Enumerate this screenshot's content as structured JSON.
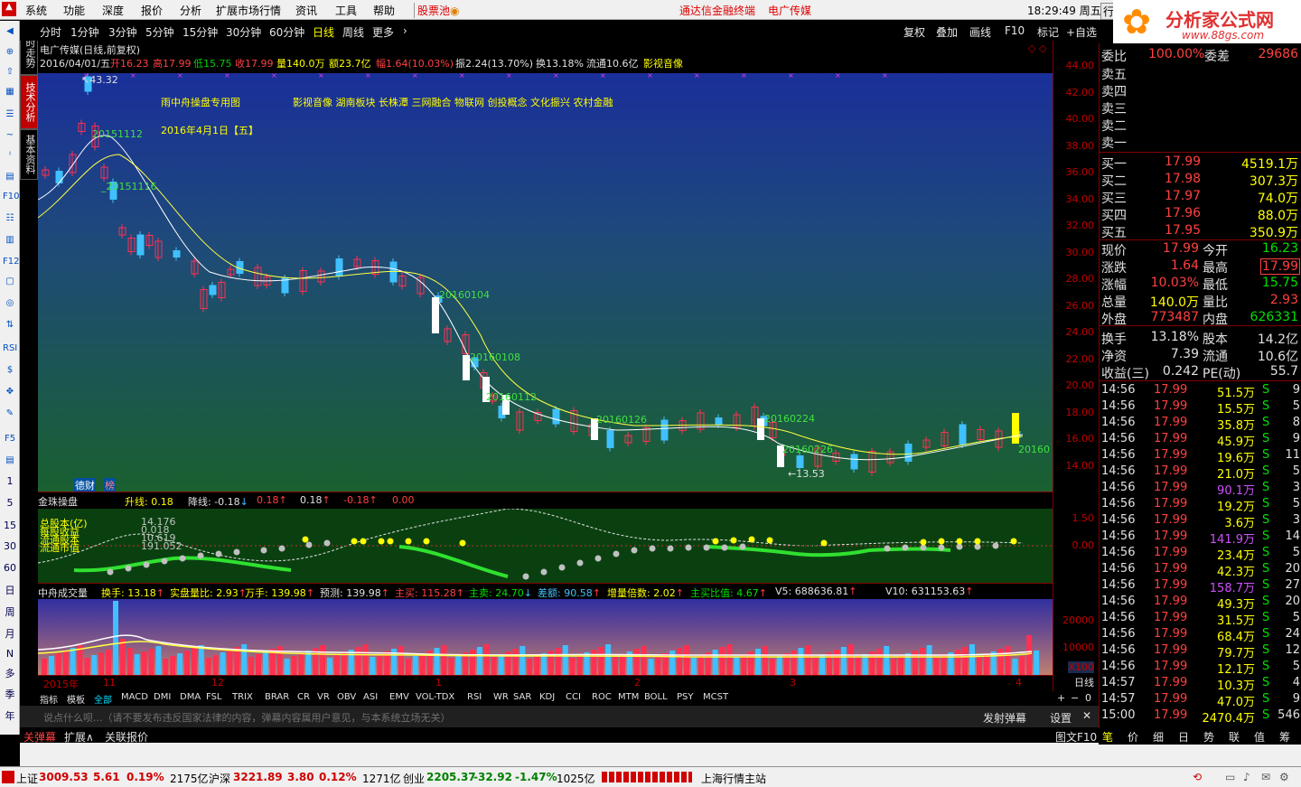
{
  "menu": {
    "items": [
      "系统",
      "功能",
      "深度",
      "报价",
      "分析",
      "扩展市场行情",
      "资讯",
      "工具",
      "帮助"
    ],
    "stockpool": "股票池",
    "promo1": "通达信金融终端",
    "promo2": "电广传媒",
    "time": "18:29:49 周五",
    "trade_btn": "行"
  },
  "logo": {
    "text": "分析家公式网",
    "url": "www.88gs.com"
  },
  "toolbar": {
    "periods": [
      "分时",
      "1分钟",
      "3分钟",
      "5分钟",
      "15分钟",
      "30分钟",
      "60分钟",
      "日线",
      "周线",
      "更多"
    ],
    "selected": "日线",
    "right": [
      "复权",
      "叠加",
      "画线",
      "F10",
      "标记",
      "+自选"
    ]
  },
  "vtabs": [
    "分时走势",
    "技术分析",
    "基本资料"
  ],
  "left_tools": [
    "◀",
    "⊕",
    "⇧",
    "▦",
    "☰",
    "~",
    "ᴵ",
    "▤",
    "F10",
    "☷",
    "▥",
    "F12",
    "▢",
    "◎",
    "⇅",
    "RSI",
    "$",
    "✥",
    "✎",
    "F5",
    "▤",
    "1",
    "5",
    "15",
    "30",
    "60",
    "日",
    "周",
    "月",
    "N",
    "多",
    "季",
    "年"
  ],
  "main_chart": {
    "title": "电广传媒(日线,前复权)",
    "info_date": "2016/04/01/五",
    "info_open": "开16.23",
    "info_high": "高17.99",
    "info_low": "低15.75",
    "info_close": "收17.99",
    "info_vol": "量140.0万",
    "info_amt": "额23.7亿",
    "info_pct": "幅1.64(10.03%)",
    "info_amp": "振2.24(13.70%)",
    "info_turn": "换13.18%",
    "info_float": "流通10.6亿",
    "info_concept": "影视音像",
    "overlay_title": "雨中舟操盘专用图",
    "overlay_concepts": "影视音像  湖南板块  长株潭  三网融合  物联网  创投概念  文化振兴  农村金融",
    "overlay_date": "2016年4月1日【五】",
    "labels": [
      "43.32",
      "20151112",
      "20151116",
      "20160104",
      "20160108",
      "20160112",
      "20160126",
      "20160224",
      "20160226",
      "←13.53",
      "20160"
    ],
    "tags": [
      "德财",
      "榜"
    ],
    "price_axis": [
      "44.00",
      "42.00",
      "40.00",
      "38.00",
      "36.00",
      "34.00",
      "32.00",
      "30.00",
      "28.00",
      "26.00",
      "24.00",
      "22.00",
      "20.00",
      "18.00",
      "16.00",
      "14.00"
    ]
  },
  "indicator1": {
    "name": "金珠操盘",
    "values": [
      "升线: 0.18",
      "降线: -0.18",
      "0.18",
      "0.18",
      "-0.18",
      "0.00"
    ],
    "legend": [
      "总股本(亿)",
      "每股收益",
      "流通股本",
      "流通市值"
    ],
    "legend_vals": [
      "14.176",
      "0.018",
      "10.619",
      "191.052"
    ],
    "axis": [
      "1.50",
      "0.00"
    ]
  },
  "indicator2": {
    "name": "中舟成交量",
    "values": [
      "换手: 13.18",
      "实盘量比: 2.93",
      "万手: 139.98",
      "预测: 139.98",
      "主买: 115.28",
      "主卖: 24.70",
      "差额: 90.58",
      "增量倍数: 2.02",
      "主买比值: 4.67",
      "V5: 688636.81",
      "V10: 631153.63"
    ],
    "axis": [
      "20000",
      "10000",
      "X100"
    ],
    "months": [
      "2015年",
      "11",
      "12",
      "1",
      "2",
      "3",
      "4"
    ]
  },
  "bottom_tabs": [
    "指标",
    "模板",
    "全部",
    "MACD",
    "DMI",
    "DMA",
    "FSL",
    "TRIX",
    "BRAR",
    "CR",
    "VR",
    "OBV",
    "ASI",
    "EMV",
    "VOL-TDX",
    "RSI",
    "WR",
    "SAR",
    "KDJ",
    "CCI",
    "ROC",
    "MTM",
    "BOLL",
    "PSY",
    "MCST"
  ],
  "danmu": {
    "placeholder": "说点什么呗...（请不要发布违反国家法律的内容，弹幕内容属用户意见，与本系统立场无关）",
    "send": "发射弹幕",
    "settings": "设置"
  },
  "bar2": {
    "items": [
      "关弹幕",
      "扩展∧",
      "关联报价"
    ],
    "right": "图文F10",
    "period": "日线"
  },
  "quote": {
    "weibi": "委比",
    "weibi_val": "100.00%",
    "weicha": "委差",
    "weicha_val": "29686",
    "sell": [
      {
        "l": "卖五"
      },
      {
        "l": "卖四"
      },
      {
        "l": "卖三"
      },
      {
        "l": "卖二"
      },
      {
        "l": "卖一"
      }
    ],
    "buy": [
      {
        "l": "买一",
        "p": "17.99",
        "v": "4519.1万"
      },
      {
        "l": "买二",
        "p": "17.98",
        "v": "307.3万"
      },
      {
        "l": "买三",
        "p": "17.97",
        "v": "74.0万"
      },
      {
        "l": "买四",
        "p": "17.96",
        "v": "88.0万"
      },
      {
        "l": "买五",
        "p": "17.95",
        "v": "350.9万"
      }
    ],
    "stats": [
      {
        "a": "现价",
        "av": "17.99",
        "b": "今开",
        "bv": "16.23"
      },
      {
        "a": "涨跌",
        "av": "1.64",
        "b": "最高",
        "bv": "17.99"
      },
      {
        "a": "涨幅",
        "av": "10.03%",
        "b": "最低",
        "bv": "15.75"
      },
      {
        "a": "总量",
        "av": "140.0万",
        "b": "量比",
        "bv": "2.93"
      },
      {
        "a": "外盘",
        "av": "773487",
        "b": "内盘",
        "bv": "626331"
      },
      {
        "a": "换手",
        "av": "13.18%",
        "b": "股本",
        "bv": "14.2亿"
      },
      {
        "a": "净资",
        "av": "7.39",
        "b": "流通",
        "bv": "10.6亿"
      },
      {
        "a": "收益(三)",
        "av": "0.242",
        "b": "PE(动)",
        "bv": "55.7"
      }
    ],
    "ticks": [
      {
        "t": "14:56",
        "p": "17.99",
        "v": "51.5万",
        "s": "S",
        "n": "9"
      },
      {
        "t": "14:56",
        "p": "17.99",
        "v": "15.5万",
        "s": "S",
        "n": "5"
      },
      {
        "t": "14:56",
        "p": "17.99",
        "v": "35.8万",
        "s": "S",
        "n": "8"
      },
      {
        "t": "14:56",
        "p": "17.99",
        "v": "45.9万",
        "s": "S",
        "n": "9"
      },
      {
        "t": "14:56",
        "p": "17.99",
        "v": "19.6万",
        "s": "S",
        "n": "11"
      },
      {
        "t": "14:56",
        "p": "17.99",
        "v": "21.0万",
        "s": "S",
        "n": "5"
      },
      {
        "t": "14:56",
        "p": "17.99",
        "v": "90.1万",
        "s": "S",
        "n": "3"
      },
      {
        "t": "14:56",
        "p": "17.99",
        "v": "19.2万",
        "s": "S",
        "n": "5"
      },
      {
        "t": "14:56",
        "p": "17.99",
        "v": "3.6万",
        "s": "S",
        "n": "3"
      },
      {
        "t": "14:56",
        "p": "17.99",
        "v": "141.9万",
        "s": "S",
        "n": "14"
      },
      {
        "t": "14:56",
        "p": "17.99",
        "v": "23.4万",
        "s": "S",
        "n": "5"
      },
      {
        "t": "14:56",
        "p": "17.99",
        "v": "42.3万",
        "s": "S",
        "n": "20"
      },
      {
        "t": "14:56",
        "p": "17.99",
        "v": "158.7万",
        "s": "S",
        "n": "27"
      },
      {
        "t": "14:56",
        "p": "17.99",
        "v": "49.3万",
        "s": "S",
        "n": "20"
      },
      {
        "t": "14:56",
        "p": "17.99",
        "v": "31.5万",
        "s": "S",
        "n": "5"
      },
      {
        "t": "14:56",
        "p": "17.99",
        "v": "68.4万",
        "s": "S",
        "n": "24"
      },
      {
        "t": "14:56",
        "p": "17.99",
        "v": "79.7万",
        "s": "S",
        "n": "12"
      },
      {
        "t": "14:56",
        "p": "17.99",
        "v": "12.1万",
        "s": "S",
        "n": "5"
      },
      {
        "t": "14:57",
        "p": "17.99",
        "v": "10.3万",
        "s": "S",
        "n": "4"
      },
      {
        "t": "14:57",
        "p": "17.99",
        "v": "47.0万",
        "s": "S",
        "n": "9"
      },
      {
        "t": "15:00",
        "p": "17.99",
        "v": "2470.4万",
        "s": "S",
        "n": "546"
      }
    ],
    "tabs": [
      "笔",
      "价",
      "细",
      "日",
      "势",
      "联",
      "值",
      "筹"
    ]
  },
  "status": {
    "sh": "上证",
    "sh_v": "3009.53",
    "sh_c": "5.61",
    "sh_p": "0.19%",
    "sh_a": "2175亿",
    "hs": "沪深",
    "hs_v": "3221.89",
    "hs_c": "3.80",
    "hs_p": "0.12%",
    "hs_a": "1271亿",
    "cy": "创业",
    "cy_v": "2205.37",
    "cy_c": "-32.92",
    "cy_p": "-1.47%",
    "cy_a": "1025亿",
    "station": "上海行情主站"
  }
}
